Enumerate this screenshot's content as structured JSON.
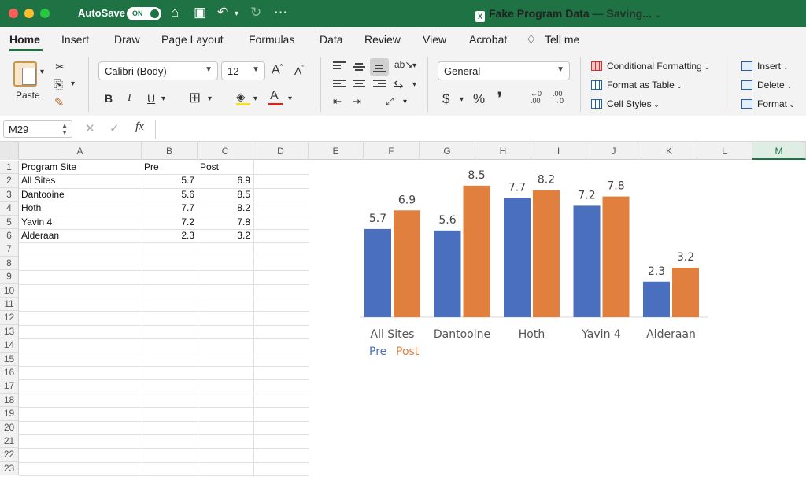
{
  "titlebar": {
    "autosave_label": "AutoSave",
    "autosave_state": "ON",
    "doc_name": "Fake Program Data",
    "doc_status": " — Saving...",
    "xl_badge": "X"
  },
  "ribbon_tabs": [
    "Home",
    "Insert",
    "Draw",
    "Page Layout",
    "Formulas",
    "Data",
    "Review",
    "View",
    "Acrobat",
    "Tell me"
  ],
  "ribbon": {
    "paste_label": "Paste",
    "font_name": "Calibri (Body)",
    "font_size": "12",
    "bold": "B",
    "italic": "I",
    "underline": "U",
    "number_format": "General",
    "currency": "$",
    "percent": "%",
    "comma": "❜",
    "dec_increase": "←.0 .00",
    "conditional_formatting": "Conditional Formatting",
    "format_as_table": "Format as Table",
    "cell_styles": "Cell Styles",
    "insert": "Insert",
    "delete": "Delete",
    "format": "Format",
    "colors": {
      "highlight": "#f5e21b",
      "font_color": "#e02020"
    }
  },
  "formula_bar": {
    "name_box": "M29",
    "fx": "fx",
    "formula": ""
  },
  "grid": {
    "columns": [
      "A",
      "B",
      "C",
      "D",
      "E",
      "F",
      "G",
      "H",
      "I",
      "J",
      "K",
      "L",
      "M"
    ],
    "selected_column": "M",
    "rows": [
      "1",
      "2",
      "3",
      "4",
      "5",
      "6",
      "7",
      "8",
      "9",
      "10",
      "11",
      "12",
      "13",
      "14",
      "15",
      "16",
      "17",
      "18",
      "19",
      "20",
      "21",
      "22",
      "23"
    ],
    "header": [
      "Program Site",
      "Pre",
      "Post"
    ],
    "data": [
      [
        "All Sites",
        "5.7",
        "6.9"
      ],
      [
        "Dantooine",
        "5.6",
        "8.5"
      ],
      [
        "Hoth",
        "7.7",
        "8.2"
      ],
      [
        "Yavin 4",
        "7.2",
        "7.8"
      ],
      [
        "Alderaan",
        "2.3",
        "3.2"
      ]
    ]
  },
  "chart_data": {
    "type": "bar",
    "categories": [
      "All Sites",
      "Dantooine",
      "Hoth",
      "Yavin 4",
      "Alderaan"
    ],
    "series": [
      {
        "name": "Pre",
        "values": [
          5.7,
          5.6,
          7.7,
          7.2,
          2.3
        ],
        "color": "#4a6fbf"
      },
      {
        "name": "Post",
        "values": [
          6.9,
          8.5,
          8.2,
          7.8,
          3.2
        ],
        "color": "#e07f3e"
      }
    ],
    "value_labels": {
      "Pre": [
        "5.7",
        "5.6",
        "7.7",
        "7.2",
        "2.3"
      ],
      "Post": [
        "6.9",
        "8.5",
        "8.2",
        "7.8",
        "3.2"
      ]
    },
    "title": "",
    "xlabel": "",
    "ylabel": "",
    "ylim": [
      0,
      9
    ],
    "grid": false,
    "legend": "bottom-left"
  }
}
